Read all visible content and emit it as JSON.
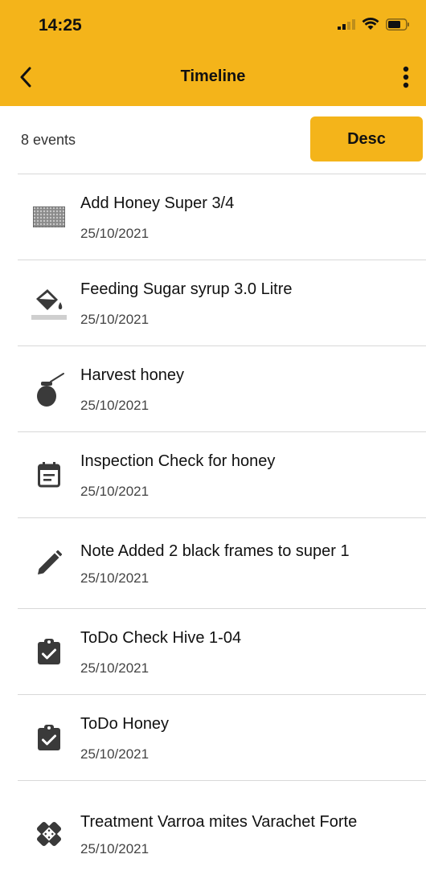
{
  "status": {
    "time": "14:25"
  },
  "nav": {
    "title": "Timeline"
  },
  "toolbar": {
    "count": "8 events",
    "sort_label": "Desc"
  },
  "colors": {
    "accent": "#f4b41a",
    "icon": "#3a3a3a",
    "divider": "#d8d8d8"
  },
  "events": [
    {
      "title": "Add Honey Super 3/4",
      "date": "25/10/2021",
      "icon": "honeycomb-super-icon"
    },
    {
      "title": "Feeding Sugar syrup 3.0 Litre",
      "date": "25/10/2021",
      "icon": "paint-bucket-icon"
    },
    {
      "title": "Harvest honey",
      "date": "25/10/2021",
      "icon": "honey-pot-icon"
    },
    {
      "title": "Inspection Check for honey",
      "date": "25/10/2021",
      "icon": "calendar-note-icon"
    },
    {
      "title": "Note Added 2 black frames to super 1",
      "date": "25/10/2021",
      "icon": "pencil-icon"
    },
    {
      "title": "ToDo Check Hive 1-04",
      "date": "25/10/2021",
      "icon": "clipboard-check-icon"
    },
    {
      "title": "ToDo Honey",
      "date": "25/10/2021",
      "icon": "clipboard-check-icon"
    },
    {
      "title": "Treatment Varroa mites Varachet Forte",
      "date": "25/10/2021",
      "icon": "bandage-icon"
    }
  ]
}
